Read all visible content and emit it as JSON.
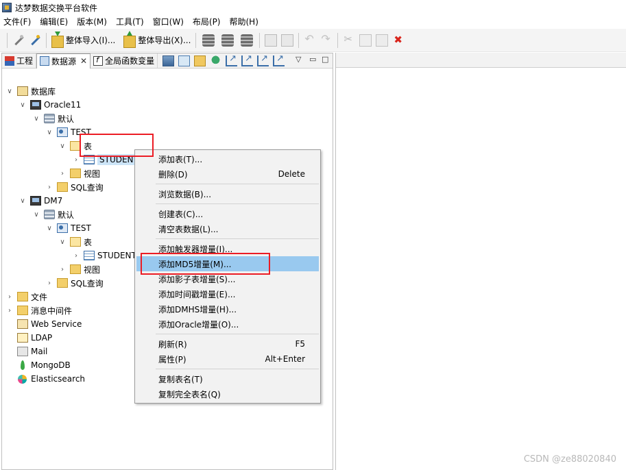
{
  "window": {
    "title": "达梦数据交换平台软件"
  },
  "menubar": {
    "items": [
      "文件(F)",
      "编辑(E)",
      "版本(M)",
      "工具(T)",
      "窗口(W)",
      "布局(P)",
      "帮助(H)"
    ]
  },
  "toolbar": {
    "import_label": "整体导入(I)...",
    "export_label": "整体导出(X)..."
  },
  "left_tabs": {
    "project": "工程",
    "datasource": "数据源",
    "datasource_close": "✕",
    "globals": "全局函数变量"
  },
  "tree": {
    "root": "数据库",
    "oracle": "Oracle11",
    "default1": "默认",
    "test1": "TEST",
    "table1": "表",
    "student1": "STUDENT",
    "view1": "视图",
    "sql1": "SQL查询",
    "dm7": "DM7",
    "default2": "默认",
    "test2": "TEST",
    "table2": "表",
    "student2": "STUDENT",
    "view2": "视图",
    "sql2": "SQL查询",
    "file": "文件",
    "mq": "消息中间件",
    "webservice": "Web Service",
    "ldap": "LDAP",
    "mail": "Mail",
    "mongodb": "MongoDB",
    "elasticsearch": "Elasticsearch"
  },
  "context_menu": {
    "add_table": "添加表(T)...",
    "delete": "删除(D)",
    "delete_key": "Delete",
    "browse": "浏览数据(B)...",
    "create_table": "创建表(C)...",
    "truncate": "清空表数据(L)...",
    "add_trigger": "添加触发器增量(I)...",
    "add_md5": "添加MD5增量(M)...",
    "add_shadow": "添加影子表增量(S)...",
    "add_timestamp": "添加时间戳增量(E)...",
    "add_dmhs": "添加DMHS增量(H)...",
    "add_oracle": "添加Oracle增量(O)...",
    "refresh": "刷新(R)",
    "refresh_key": "F5",
    "properties": "属性(P)",
    "properties_key": "Alt+Enter",
    "copy_name": "复制表名(T)",
    "copy_full_name": "复制完全表名(Q)"
  },
  "watermark": "CSDN @ze88020840",
  "colors": {
    "highlight_red": "#ec1c24",
    "menu_hover": "#99c9ef",
    "selection": "#cce4f7"
  }
}
